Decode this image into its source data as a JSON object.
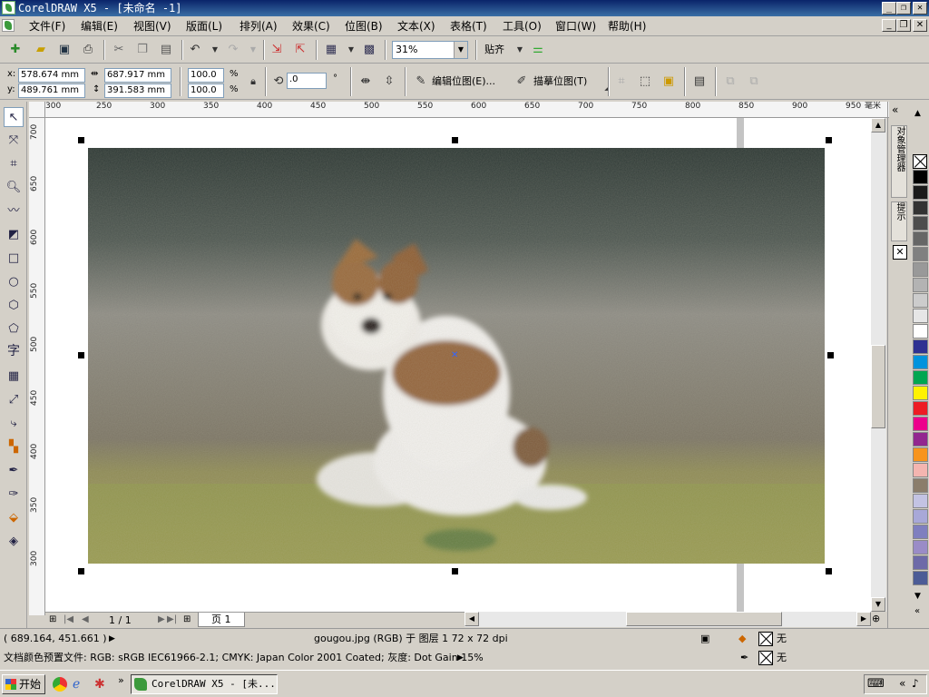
{
  "window": {
    "title": "CorelDRAW X5 - [未命名 -1]",
    "min": "_",
    "max": "❐",
    "close": "✕"
  },
  "menu": [
    "文件(F)",
    "编辑(E)",
    "视图(V)",
    "版面(L)",
    "排列(A)",
    "效果(C)",
    "位图(B)",
    "文本(X)",
    "表格(T)",
    "工具(O)",
    "窗口(W)",
    "帮助(H)"
  ],
  "toolbar": {
    "zoom": "31%",
    "snap_label": "贴齐"
  },
  "propbar": {
    "x": "578.674 mm",
    "y": "489.761 mm",
    "w": "687.917 mm",
    "h": "391.583 mm",
    "scale_x": "100.0",
    "scale_y": "100.0",
    "pct": "%",
    "angle": ".0",
    "deg": "°",
    "edit_bitmap": "编辑位图(E)...",
    "trace_bitmap": "描摹位图(T)"
  },
  "ruler": {
    "top": [
      "300",
      "250",
      "300",
      "350",
      "400",
      "450",
      "500",
      "550",
      "600",
      "650",
      "700",
      "750",
      "800",
      "850",
      "900",
      "950"
    ],
    "unit": "毫米",
    "left": [
      "700",
      "650",
      "600",
      "550",
      "500",
      "450",
      "400",
      "350",
      "300"
    ]
  },
  "pagenav": {
    "count": "1 / 1",
    "tab": "页 1"
  },
  "docker": {
    "tab1": "对象管理器",
    "tab2": "提示"
  },
  "palette": [
    "#ffffff",
    "#000000",
    "#1a1a1a",
    "#333333",
    "#4d4d4d",
    "#666666",
    "#808080",
    "#999999",
    "#b3b3b3",
    "#cccccc",
    "#e6e6e6",
    "#ffffff",
    "#2e3192",
    "#0093dd",
    "#00a651",
    "#fff200",
    "#ed1c24",
    "#ec008c",
    "#92278f",
    "#f7941d",
    "#f4b5b0",
    "#8b7d6b",
    "#c3c3e3",
    "#a8a8d8",
    "#7f7fbf",
    "#9a8cc7",
    "#6d6aa8",
    "#4c5c96"
  ],
  "status": {
    "coords": "( 689.164, 451.661 )",
    "object": "gougou.jpg (RGB) 于 图层 1 72 x 72 dpi",
    "profile": "文档颜色预置文件: RGB: sRGB IEC61966-2.1; CMYK: Japan Color 2001 Coated; 灰度: Dot Gain 15%",
    "fill": "无",
    "outline": "无"
  },
  "taskbar": {
    "start": "开始",
    "item": "CorelDRAW X5 - [未..."
  }
}
